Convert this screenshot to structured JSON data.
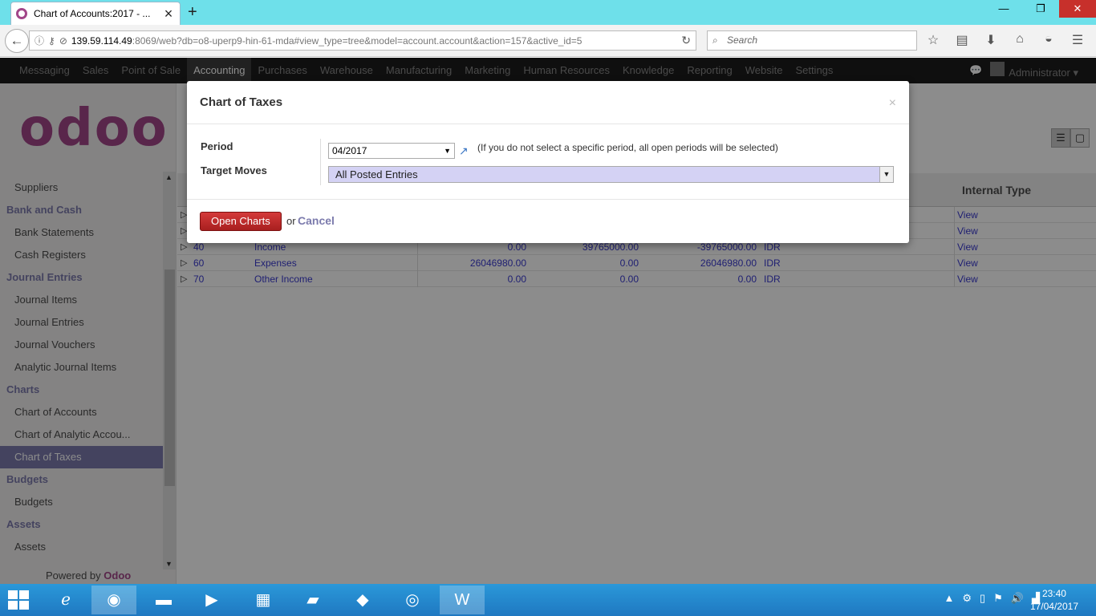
{
  "browser": {
    "tab_title": "Chart of Accounts:2017 - ...",
    "url_host": "139.59.114.49",
    "url_path": ":8069/web?db=o8-uperp9-hin-61-mda#view_type=tree&model=account.account&action=157&active_id=5",
    "search_placeholder": "Search"
  },
  "topmenu": {
    "items": [
      "Messaging",
      "Sales",
      "Point of Sale",
      "Accounting",
      "Purchases",
      "Warehouse",
      "Manufacturing",
      "Marketing",
      "Human Resources",
      "Knowledge",
      "Reporting",
      "Website",
      "Settings"
    ],
    "active": "Accounting",
    "user": "Administrator"
  },
  "sidebar": {
    "logo": "odoo",
    "items": [
      {
        "t": "i",
        "label": "Suppliers"
      },
      {
        "t": "h",
        "label": "Bank and Cash"
      },
      {
        "t": "i",
        "label": "Bank Statements"
      },
      {
        "t": "i",
        "label": "Cash Registers"
      },
      {
        "t": "h",
        "label": "Journal Entries"
      },
      {
        "t": "i",
        "label": "Journal Items"
      },
      {
        "t": "i",
        "label": "Journal Entries"
      },
      {
        "t": "i",
        "label": "Journal Vouchers"
      },
      {
        "t": "i",
        "label": "Analytic Journal Items"
      },
      {
        "t": "h",
        "label": "Charts"
      },
      {
        "t": "i",
        "label": "Chart of Accounts"
      },
      {
        "t": "i",
        "label": "Chart of Analytic Accou..."
      },
      {
        "t": "a",
        "label": "Chart of Taxes"
      },
      {
        "t": "h",
        "label": "Budgets"
      },
      {
        "t": "i",
        "label": "Budgets"
      },
      {
        "t": "h",
        "label": "Assets"
      },
      {
        "t": "i",
        "label": "Assets"
      }
    ],
    "powered_prefix": "Powered by",
    "powered_brand": "Odoo"
  },
  "grid": {
    "internal_type_header": "Internal Type",
    "rows": [
      {
        "code": "",
        "name": "",
        "debit": "",
        "credit": "",
        "balance": "",
        "currency": "",
        "type": "View"
      },
      {
        "code": "",
        "name": "",
        "debit": "",
        "credit": "",
        "balance": "",
        "currency": "",
        "type": "View"
      },
      {
        "code": "40",
        "name": "Income",
        "debit": "0.00",
        "credit": "39765000.00",
        "balance": "-39765000.00",
        "currency": "IDR",
        "type": "View"
      },
      {
        "code": "60",
        "name": "Expenses",
        "debit": "26046980.00",
        "credit": "0.00",
        "balance": "26046980.00",
        "currency": "IDR",
        "type": "View"
      },
      {
        "code": "70",
        "name": "Other Income",
        "debit": "0.00",
        "credit": "0.00",
        "balance": "0.00",
        "currency": "IDR",
        "type": "View"
      }
    ]
  },
  "dialog": {
    "title": "Chart of Taxes",
    "period_label": "Period",
    "period_value": "04/2017",
    "period_hint": "(If you do not select a specific period, all open periods will be selected)",
    "moves_label": "Target Moves",
    "moves_value": "All Posted Entries",
    "open_button": "Open Charts",
    "or_text": "or",
    "cancel_link": "Cancel"
  },
  "taskbar": {
    "time": "23:40",
    "date": "17/04/2017"
  }
}
